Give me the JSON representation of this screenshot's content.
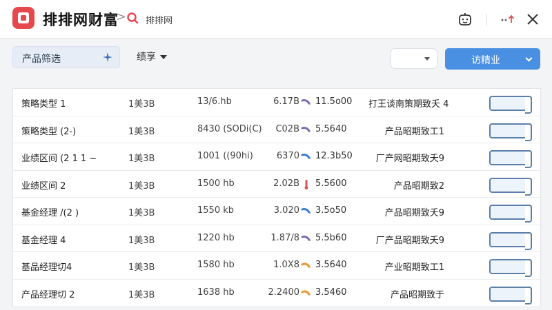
{
  "titlebar": {
    "app_title": "排排网财富",
    "crumb_separator": ">",
    "crumb_text": "排排网",
    "icons": [
      "logo-icon",
      "search-icon",
      "robot-icon",
      "more-icon",
      "close-icon"
    ]
  },
  "filterbar": {
    "filter_label": "产品筛选",
    "sort_label": "绩享",
    "select_value": "",
    "primary_label": "访精业"
  },
  "colors": {
    "brand_red": "#e5484d",
    "primary_blue": "#4a90e2",
    "toggle_border": "#5b7fa8"
  },
  "rows": [
    {
      "name": "策略类型 1",
      "a": "1美3B",
      "b": "13/6.hb",
      "c": "6.17B",
      "icon": "purple-arrow",
      "d": "11.5o00",
      "desc": "打王谈南策期致夭 4"
    },
    {
      "name": "策略类型 (2-)",
      "a": "1美3B",
      "b": "8430 (SODi(C)",
      "c": "C02B",
      "icon": "purple-arrow",
      "d": "5.5640",
      "desc": "产品昭期致工1"
    },
    {
      "name": "业绩区间 (2 1 1 ~",
      "a": "1美3B",
      "b": "1001 ((90hi)",
      "c": "6370",
      "icon": "blue-arrow",
      "d": "12.3b50",
      "desc": "厂产网昭期致夭9"
    },
    {
      "name": "业绩区间 2",
      "a": "1美3B",
      "b": "1500 hb",
      "c": "2.02B",
      "icon": "red-thermometer",
      "d": "5.5600",
      "desc": "产品昭期致2"
    },
    {
      "name": "基金经理 /(2 )",
      "a": "1美3B",
      "b": "1550 kb",
      "c": "3.020",
      "icon": "blue-arrow",
      "d": "3.5o50",
      "desc": "产品昭期致夭9"
    },
    {
      "name": "基金经理 4",
      "a": "1美3B",
      "b": "1220 hb",
      "c": "1.87/8",
      "icon": "purple-arrow",
      "d": "5.5b60",
      "desc": "厂产品昭期致夭9"
    },
    {
      "name": "基品经理切4",
      "a": "1美3B",
      "b": "1580 hb",
      "c": "1.0X8",
      "icon": "orange-arrow",
      "d": "3.5640",
      "desc": "产业昭期致工1"
    },
    {
      "name": "产品经理切 2",
      "a": "1美3B",
      "b": "1638 hb",
      "c": "2.2400",
      "icon": "orange-arrow",
      "d": "3.5460",
      "desc": "产品昭期致于"
    }
  ]
}
